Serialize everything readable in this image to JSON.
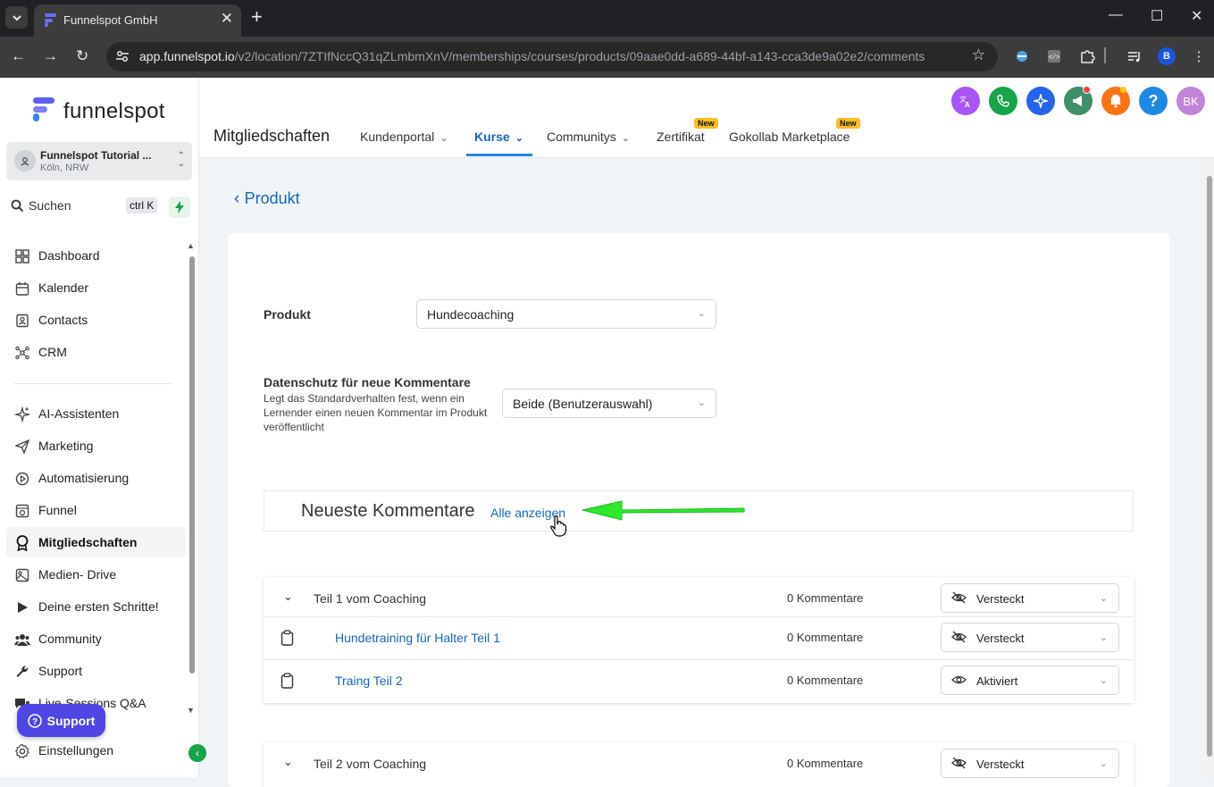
{
  "browser": {
    "tab_title": "Funnelspot GmbH",
    "url_host": "app.funnelspot.io",
    "url_path": "/v2/location/7ZTIfNccQ31qZLmbmXnV/memberships/courses/products/09aae0dd-a689-44bf-a143-cca3de9a02e2/comments",
    "profile_initial": "B"
  },
  "sidebar": {
    "logo_text": "funnelspot",
    "location": {
      "name": "Funnelspot Tutorial ...",
      "sub": "Köln, NRW"
    },
    "search": {
      "label": "Suchen",
      "shortcut": "ctrl K"
    },
    "items": [
      {
        "label": "Dashboard",
        "icon": "dashboard-icon"
      },
      {
        "label": "Kalender",
        "icon": "calendar-icon"
      },
      {
        "label": "Contacts",
        "icon": "contacts-icon"
      },
      {
        "label": "CRM",
        "icon": "crm-icon"
      },
      {
        "label": "AI-Assistenten",
        "icon": "sparkle-icon"
      },
      {
        "label": "Marketing",
        "icon": "send-icon"
      },
      {
        "label": "Automatisierung",
        "icon": "automation-icon"
      },
      {
        "label": "Funnel",
        "icon": "funnel-icon"
      },
      {
        "label": "Mitgliedschaften",
        "icon": "badge-icon",
        "active": true
      },
      {
        "label": "Medien- Drive",
        "icon": "image-icon"
      },
      {
        "label": "Deine ersten Schritte!",
        "icon": "play-icon"
      },
      {
        "label": "Community",
        "icon": "people-icon"
      },
      {
        "label": "Support",
        "icon": "wrench-icon"
      },
      {
        "label": "Live-Sessions Q&A",
        "icon": "chat-icon"
      },
      {
        "label": "Einstellungen",
        "icon": "gear-icon"
      }
    ],
    "support_button": "Support"
  },
  "topnav": {
    "title": "Mitgliedschaften",
    "tabs": [
      {
        "label": "Kundenportal",
        "dropdown": true
      },
      {
        "label": "Kurse",
        "dropdown": true,
        "active": true
      },
      {
        "label": "Communitys",
        "dropdown": true
      },
      {
        "label": "Zertifikat",
        "badge": "New"
      },
      {
        "label": "Gokollab Marketplace",
        "badge": "New"
      }
    ],
    "avatar_initials": "BK",
    "icon_colors": {
      "translate": "#a855f7",
      "phone": "#16a34a",
      "ai": "#2563eb",
      "announce": "#3f8f6b",
      "bell": "#f97316",
      "help": "#1e88e5",
      "avatar": "#c084d8"
    }
  },
  "main": {
    "back_label": "Produkt",
    "product_label": "Produkt",
    "product_value": "Hundecoaching",
    "privacy_label": "Datenschutz für neue Kommentare",
    "privacy_desc": [
      "Legt das Standardverhalten fest, wenn ein",
      "Lernender einen neuen Kommentar im Produkt",
      "veröffentlicht"
    ],
    "privacy_value": "Beide (Benutzerauswahl)",
    "recent_heading": "Neueste Kommentare",
    "recent_link": "Alle anzeigen",
    "groups": [
      {
        "title": "Teil 1 vom Coaching",
        "count": "0 Kommentare",
        "visibility": "Versteckt",
        "lessons": [
          {
            "title": "Hundetraining für Halter Teil 1",
            "count": "0 Kommentare",
            "visibility": "Versteckt"
          },
          {
            "title": "Traing Teil 2",
            "count": "0 Kommentare",
            "visibility": "Aktiviert"
          }
        ]
      },
      {
        "title": "Teil 2 vom Coaching",
        "count": "0 Kommentare",
        "visibility": "Versteckt",
        "lessons": []
      }
    ]
  },
  "colors": {
    "accent_blue": "#1565c0",
    "arrow_green": "#2ee82e"
  }
}
